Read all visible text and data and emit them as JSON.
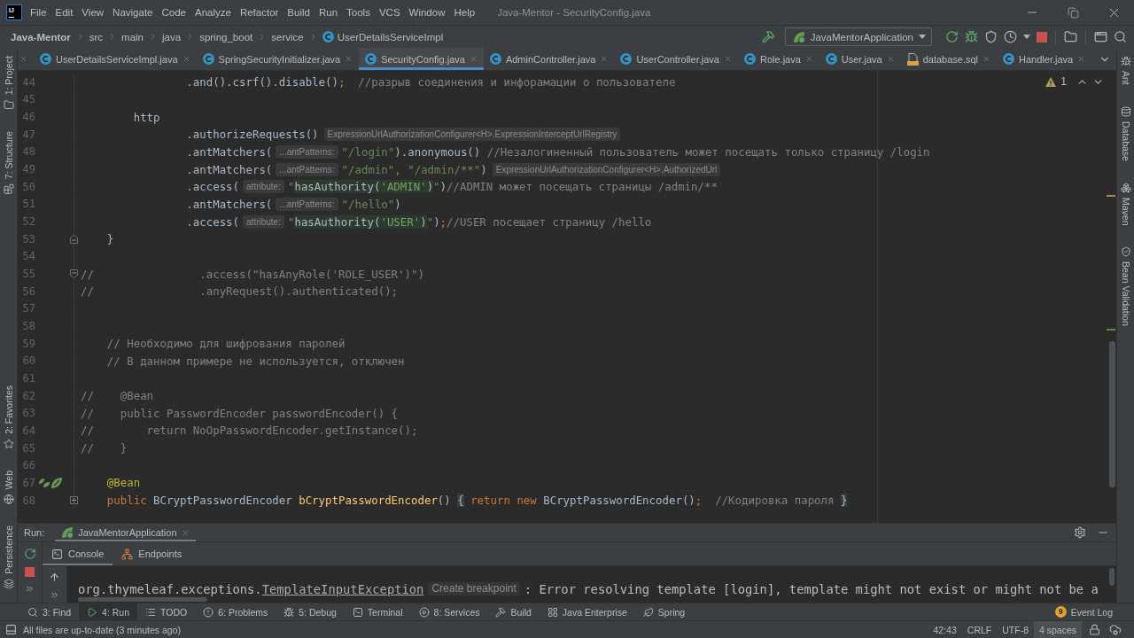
{
  "window": {
    "title": "Java-Mentor - SecurityConfig.java"
  },
  "app_logo": "IJ",
  "menu": [
    "File",
    "Edit",
    "View",
    "Navigate",
    "Code",
    "Analyze",
    "Refactor",
    "Build",
    "Run",
    "Tools",
    "VCS",
    "Window",
    "Help"
  ],
  "breadcrumbs": [
    {
      "label": "Java-Mentor",
      "kind": "project"
    },
    {
      "label": "src",
      "kind": "folder"
    },
    {
      "label": "main",
      "kind": "folder"
    },
    {
      "label": "java",
      "kind": "folder"
    },
    {
      "label": "spring_boot",
      "kind": "folder"
    },
    {
      "label": "service",
      "kind": "folder"
    },
    {
      "label": "UserDetailsServiceImpl",
      "kind": "class"
    }
  ],
  "run_configuration": {
    "label": "JavaMentorApplication"
  },
  "tabs": [
    {
      "label": "UserDetailsServiceImpl.java",
      "kind": "class",
      "selected": false
    },
    {
      "label": "SpringSecurityInitializer.java",
      "kind": "class",
      "selected": false
    },
    {
      "label": "SecurityConfig.java",
      "kind": "class",
      "selected": true
    },
    {
      "label": "AdminController.java",
      "kind": "class",
      "selected": false
    },
    {
      "label": "UserController.java",
      "kind": "class",
      "selected": false
    },
    {
      "label": "Role.java",
      "kind": "class",
      "selected": false
    },
    {
      "label": "User.java",
      "kind": "class",
      "selected": false
    },
    {
      "label": "database.sql",
      "kind": "sql",
      "selected": false
    },
    {
      "label": "Handler.java",
      "kind": "class",
      "selected": false
    }
  ],
  "left_strip": {
    "top": [
      {
        "label": "1: Project",
        "kind": "project"
      },
      {
        "label": "7: Structure",
        "kind": "structure"
      }
    ],
    "bottom": [
      {
        "label": "2: Favorites",
        "kind": "favorites"
      },
      {
        "label": "Web",
        "kind": "web"
      },
      {
        "label": "Persistence",
        "kind": "persistence"
      }
    ]
  },
  "right_strip": [
    {
      "label": "Ant",
      "kind": "ant"
    },
    {
      "label": "Database",
      "kind": "database"
    },
    {
      "label": "Maven",
      "kind": "maven"
    },
    {
      "label": "Bean Validation",
      "kind": "bean"
    }
  ],
  "editor": {
    "warnings": "1",
    "lines": [
      {
        "number": "44",
        "kind": "plain",
        "segments": [
          {
            "kind": "code",
            "tokens": [
              {
                "text": "                .and().csrf().disable()",
                "kind": "plain"
              },
              {
                "text": ";",
                "kind": "keyword"
              },
              {
                "text": "  //разрыв соединения и инфорамации о пользователе",
                "kind": "comment"
              }
            ]
          }
        ]
      },
      {
        "number": "45",
        "kind": "plain"
      },
      {
        "number": "46",
        "kind": "plain",
        "segments": [
          {
            "kind": "code",
            "tokens": [
              {
                "text": "        http",
                "kind": "plain"
              }
            ]
          }
        ]
      },
      {
        "number": "47",
        "kind": "plain",
        "segments": [
          {
            "kind": "code",
            "tokens": [
              {
                "text": "                .authorizeRequests()",
                "kind": "plain"
              }
            ]
          },
          {
            "kind": "type_hint",
            "text": "ExpressionUrlAuthorizationConfigurer<H>.ExpressionInterceptUrlRegistry"
          }
        ]
      },
      {
        "number": "48",
        "kind": "plain",
        "segments": [
          {
            "kind": "code",
            "tokens": [
              {
                "text": "                .antMatchers(",
                "kind": "plain"
              }
            ]
          },
          {
            "kind": "param_hint",
            "text": "...antPatterns:"
          },
          {
            "kind": "code",
            "tokens": [
              {
                "text": "\"/login\"",
                "kind": "string"
              },
              {
                "text": ").anonymous() ",
                "kind": "plain"
              },
              {
                "text": "//Незалогиненный пользователь может посещать только страницу /login",
                "kind": "comment"
              }
            ]
          }
        ]
      },
      {
        "number": "49",
        "kind": "plain",
        "segments": [
          {
            "kind": "code",
            "tokens": [
              {
                "text": "                .antMatchers(",
                "kind": "plain"
              }
            ]
          },
          {
            "kind": "param_hint",
            "text": "...antPatterns:"
          },
          {
            "kind": "code",
            "tokens": [
              {
                "text": "\"/admin\"",
                "kind": "string"
              },
              {
                "text": ", ",
                "kind": "keyword"
              },
              {
                "text": "\"/admin/**\"",
                "kind": "string"
              },
              {
                "text": ")",
                "kind": "plain"
              }
            ]
          },
          {
            "kind": "type_hint",
            "text": "ExpressionUrlAuthorizationConfigurer<H>.AuthorizedUrl"
          }
        ]
      },
      {
        "number": "50",
        "kind": "plain",
        "segments": [
          {
            "kind": "code",
            "tokens": [
              {
                "text": "                .access(",
                "kind": "plain"
              }
            ]
          },
          {
            "kind": "param_hint",
            "text": "attribute:"
          },
          {
            "kind": "code",
            "tokens": [
              {
                "text": "\"",
                "kind": "string"
              },
              {
                "text": "hasAuthority(",
                "kind": "inject"
              },
              {
                "text": "'ADMIN'",
                "kind": "inject_string"
              },
              {
                "text": ")",
                "kind": "inject"
              },
              {
                "text": "\"",
                "kind": "string"
              },
              {
                "text": ")",
                "kind": "plain"
              },
              {
                "text": "//ADMIN может посещать страницы /admin/**",
                "kind": "comment"
              }
            ]
          }
        ]
      },
      {
        "number": "51",
        "kind": "plain",
        "segments": [
          {
            "kind": "code",
            "tokens": [
              {
                "text": "                .antMatchers(",
                "kind": "plain"
              }
            ]
          },
          {
            "kind": "param_hint",
            "text": "...antPatterns:"
          },
          {
            "kind": "code",
            "tokens": [
              {
                "text": "\"/hello\"",
                "kind": "string"
              },
              {
                "text": ")",
                "kind": "plain"
              }
            ]
          }
        ]
      },
      {
        "number": "52",
        "kind": "plain",
        "segments": [
          {
            "kind": "code",
            "tokens": [
              {
                "text": "                .access(",
                "kind": "plain"
              }
            ]
          },
          {
            "kind": "param_hint",
            "text": "attribute:"
          },
          {
            "kind": "code",
            "tokens": [
              {
                "text": "\"",
                "kind": "string"
              },
              {
                "text": "hasAuthority(",
                "kind": "inject"
              },
              {
                "text": "'USER'",
                "kind": "inject_string"
              },
              {
                "text": ")",
                "kind": "inject"
              },
              {
                "text": "\"",
                "kind": "string"
              },
              {
                "text": ")",
                "kind": "plain"
              },
              {
                "text": ";",
                "kind": "keyword"
              },
              {
                "text": "//USER посещает страницу /hello",
                "kind": "comment"
              }
            ]
          }
        ]
      },
      {
        "number": "53",
        "kind": "fold_end",
        "segments": [
          {
            "kind": "code",
            "tokens": [
              {
                "text": "    }",
                "kind": "plain"
              }
            ]
          }
        ]
      },
      {
        "number": "54",
        "kind": "plain"
      },
      {
        "number": "55",
        "kind": "fold_start",
        "segments": [
          {
            "kind": "code",
            "tokens": [
              {
                "text": "//                .access(\"hasAnyRole('ROLE_USER')\")",
                "kind": "comment"
              }
            ]
          }
        ]
      },
      {
        "number": "56",
        "kind": "plain",
        "segments": [
          {
            "kind": "code",
            "tokens": [
              {
                "text": "//                .anyRequest().authenticated();",
                "kind": "comment"
              }
            ]
          }
        ]
      },
      {
        "number": "57",
        "kind": "plain"
      },
      {
        "number": "58",
        "kind": "plain"
      },
      {
        "number": "59",
        "kind": "plain",
        "segments": [
          {
            "kind": "code",
            "tokens": [
              {
                "text": "    // Необходимо для шифрования паролей",
                "kind": "comment"
              }
            ]
          }
        ]
      },
      {
        "number": "60",
        "kind": "plain",
        "segments": [
          {
            "kind": "code",
            "tokens": [
              {
                "text": "    // В данном примере не используется, отключен",
                "kind": "comment"
              }
            ]
          }
        ]
      },
      {
        "number": "61",
        "kind": "plain"
      },
      {
        "number": "62",
        "kind": "plain",
        "segments": [
          {
            "kind": "code",
            "tokens": [
              {
                "text": "//    @Bean",
                "kind": "comment"
              }
            ]
          }
        ]
      },
      {
        "number": "63",
        "kind": "plain",
        "segments": [
          {
            "kind": "code",
            "tokens": [
              {
                "text": "//    public PasswordEncoder passwordEncoder() {",
                "kind": "comment"
              }
            ]
          }
        ]
      },
      {
        "number": "64",
        "kind": "plain",
        "segments": [
          {
            "kind": "code",
            "tokens": [
              {
                "text": "//        return NoOpPasswordEncoder.getInstance();",
                "kind": "comment"
              }
            ]
          }
        ]
      },
      {
        "number": "65",
        "kind": "plain",
        "segments": [
          {
            "kind": "code",
            "tokens": [
              {
                "text": "//    }",
                "kind": "comment"
              }
            ]
          }
        ]
      },
      {
        "number": "66",
        "kind": "plain"
      },
      {
        "number": "67",
        "kind": "bean",
        "segments": [
          {
            "kind": "code",
            "tokens": [
              {
                "text": "    @Bean",
                "kind": "annotation"
              }
            ]
          }
        ]
      },
      {
        "number": "68",
        "kind": "folded",
        "segments": [
          {
            "kind": "code",
            "tokens": [
              {
                "text": "    public",
                "kind": "keyword"
              },
              {
                "text": " BCryptPasswordEncoder ",
                "kind": "plain"
              },
              {
                "text": "bCryptPasswordEncoder",
                "kind": "method"
              },
              {
                "text": "() ",
                "kind": "plain"
              },
              {
                "text": "{",
                "kind": "fold"
              },
              {
                "text": " return new",
                "kind": "keyword"
              },
              {
                "text": " BCryptPasswordEncoder()",
                "kind": "plain"
              },
              {
                "text": ";",
                "kind": "keyword"
              },
              {
                "text": "  //Кодировка пароля ",
                "kind": "comment"
              },
              {
                "text": "}",
                "kind": "fold"
              }
            ]
          }
        ]
      }
    ]
  },
  "run_panel": {
    "label": "Run:",
    "tabs": [
      {
        "label": "JavaMentorApplication",
        "selected": true
      }
    ],
    "subtabs": [
      {
        "label": "Console",
        "kind": "console",
        "selected": true
      },
      {
        "label": "Endpoints",
        "kind": "endpoints",
        "selected": false
      }
    ],
    "console": [
      {
        "kind": "text",
        "text": "org.thymeleaf.exceptions."
      },
      {
        "kind": "link",
        "text": "TemplateInputException"
      },
      {
        "kind": "hint",
        "text": "Create breakpoint"
      },
      {
        "kind": "text",
        "text": ": Error resolving template [login], template might not exist or might not be a"
      }
    ]
  },
  "tool_windows": [
    {
      "label": "3: Find",
      "kind": "find",
      "selected": false
    },
    {
      "label": "4: Run",
      "kind": "run",
      "selected": true
    },
    {
      "label": "TODO",
      "kind": "todo",
      "selected": false
    },
    {
      "label": "6: Problems",
      "kind": "problems",
      "selected": false
    },
    {
      "label": "5: Debug",
      "kind": "debug",
      "selected": false
    },
    {
      "label": "Terminal",
      "kind": "terminal",
      "selected": false
    },
    {
      "label": "8: Services",
      "kind": "services",
      "selected": false
    },
    {
      "label": "Build",
      "kind": "build",
      "selected": false
    },
    {
      "label": "Java Enterprise",
      "kind": "enterprise",
      "selected": false
    },
    {
      "label": "Spring",
      "kind": "spring",
      "selected": false
    }
  ],
  "event_log": {
    "label": "Event Log",
    "count": "9"
  },
  "status_bar": {
    "message": "All files are up-to-date (3 minutes ago)",
    "position": "42:43",
    "line_separator": "CRLF",
    "encoding": "UTF-8",
    "indent": "4 spaces"
  }
}
